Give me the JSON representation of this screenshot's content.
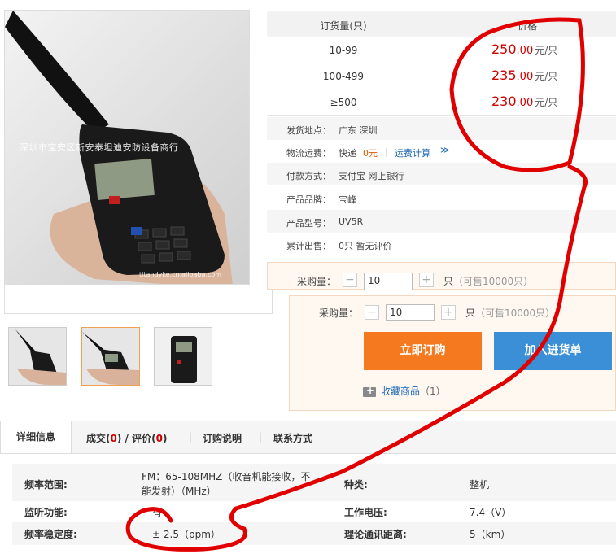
{
  "photo": {
    "watermark": "深圳市宝安区新安泰坦迪安防设备商行",
    "watermark2": "titandyke.cn.alibaba.com"
  },
  "price_table": {
    "header_qty": "订货量(只)",
    "header_price": "价格",
    "rows": [
      {
        "qty": "10-99",
        "price_int": "250",
        "price_dec": ".00",
        "unit": "元/只"
      },
      {
        "qty": "100-499",
        "price_int": "235",
        "price_dec": ".00",
        "unit": "元/只"
      },
      {
        "qty": "≥500",
        "price_int": "230",
        "price_dec": ".00",
        "unit": "元/只"
      }
    ]
  },
  "info": {
    "ship_from_label": "发货地点：",
    "ship_from": "广东 深圳",
    "logistics_label": "物流运费：",
    "logistics_express": "快递 ",
    "logistics_price": "0元",
    "logistics_sep": "|",
    "freight_calc": "运费计算",
    "payment_label": "付款方式：",
    "payment": "支付宝   网上银行",
    "brand_label": "产品品牌：",
    "brand": "宝峰",
    "model_label": "产品型号：",
    "model": "UV5R",
    "sold_label": "累计出售：",
    "sold": "0只 暂无评价"
  },
  "purchase": {
    "qty_label": "采购量：",
    "qty_value": "10",
    "qty_unit": "只",
    "available": "（可售10000只）",
    "minus": "−",
    "plus": "+"
  },
  "buttons": {
    "order": "立即订购",
    "cart": "加入进货单"
  },
  "favorite": {
    "label": "收藏商品",
    "count": "（1）"
  },
  "tabs": {
    "details": "详细信息",
    "deals_prefix": "成交(",
    "deals_count": "0",
    "deals_mid": ") / 评价(",
    "reviews_count": "0",
    "deals_suffix": ")",
    "order_notes": "订购说明",
    "contact": "联系方式",
    "sep": "|"
  },
  "specs": [
    {
      "k1": "频率范围:",
      "v1a": "FM：65-108MHZ（收音机能接收，不",
      "v1b": "能发射）（MHz）",
      "k2": "种类:",
      "v2": "整机"
    },
    {
      "k1": "监听功能:",
      "v1a": "有",
      "k2": "工作电压:",
      "v2": "7.4（V）"
    },
    {
      "k1": "频率稳定度:",
      "v1a": "± 2.5（ppm）",
      "k2": "理论通讯距离:",
      "v2": "5（km）"
    }
  ],
  "colors": {
    "price_red": "#cc0000",
    "order_orange": "#f5791f",
    "cart_blue": "#3a8fd6",
    "annotation_red": "#e00000"
  }
}
